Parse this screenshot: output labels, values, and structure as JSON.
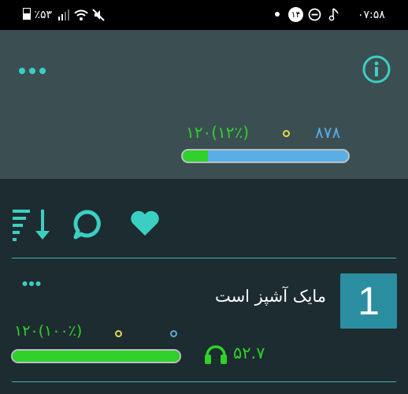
{
  "status_bar": {
    "time": "۰۷:۵۸",
    "notification_count": "۱۴",
    "battery": "٪۵۳"
  },
  "header": {
    "stats": {
      "green": "۱۲۰(۱۲٪)",
      "blue": "۸۷۸"
    },
    "progress": 0.15
  },
  "actions": [
    "sort-icon",
    "comment-icon",
    "heart-icon"
  ],
  "list": [
    {
      "rank": "1",
      "title": "مایک آشپز است",
      "green_stat": "۱۲۰(۱۰۰٪)",
      "listen_count": "۵۲.۷",
      "progress": 1.0
    }
  ],
  "colors": {
    "accent": "#3bcfc4",
    "green": "#2fd12a",
    "blue": "#5aaee6",
    "yellow": "#e0dc4c"
  }
}
